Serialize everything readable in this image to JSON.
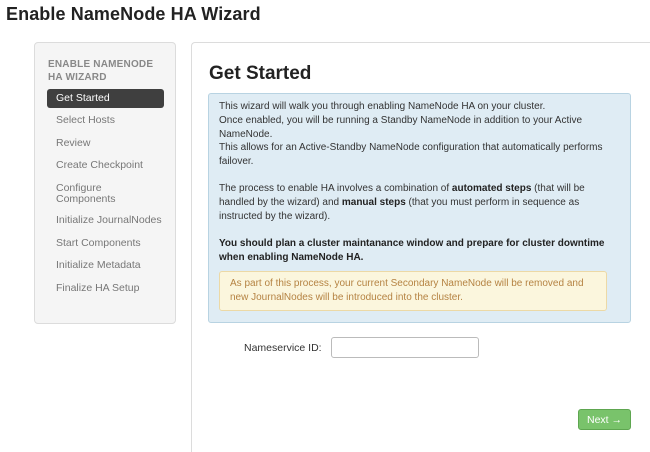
{
  "page": {
    "title": "Enable NameNode HA Wizard"
  },
  "sidebar": {
    "header": "ENABLE NAMENODE HA WIZARD",
    "items": [
      {
        "label": "Get Started",
        "active": true
      },
      {
        "label": "Select Hosts",
        "active": false
      },
      {
        "label": "Review",
        "active": false
      },
      {
        "label": "Create Checkpoint",
        "active": false
      },
      {
        "label": "Configure Components",
        "active": false
      },
      {
        "label": "Initialize JournalNodes",
        "active": false
      },
      {
        "label": "Start Components",
        "active": false
      },
      {
        "label": "Initialize Metadata",
        "active": false
      },
      {
        "label": "Finalize HA Setup",
        "active": false
      }
    ]
  },
  "main": {
    "title": "Get Started",
    "intro": {
      "line1": "This wizard will walk you through enabling NameNode HA on your cluster.",
      "line2": "Once enabled, you will be running a Standby NameNode in addition to your Active NameNode.",
      "line3": "This allows for an Active-Standby NameNode configuration that automatically performs failover."
    },
    "process": {
      "part1": "The process to enable HA involves a combination of ",
      "bold1": "automated steps",
      "part2": " (that will be handled by the wizard) and ",
      "bold2": "manual steps",
      "part3": " (that you must perform in sequence as instructed by the wizard)."
    },
    "maintenance_note": "You should plan a cluster maintanance window and prepare for cluster downtime when enabling NameNode HA.",
    "warning": "As part of this process, your current Secondary NameNode will be removed and new JournalNodes will be introduced into the cluster.",
    "nameservice": {
      "label": "Nameservice ID:",
      "value": "",
      "placeholder": ""
    },
    "next_button": "Next →"
  },
  "colors": {
    "info_bg": "#dfecf4",
    "warning_bg": "#fbf6dd",
    "warning_text": "#b58343",
    "next_button_bg": "#79c36b",
    "active_item_bg": "#3f3f3f"
  }
}
